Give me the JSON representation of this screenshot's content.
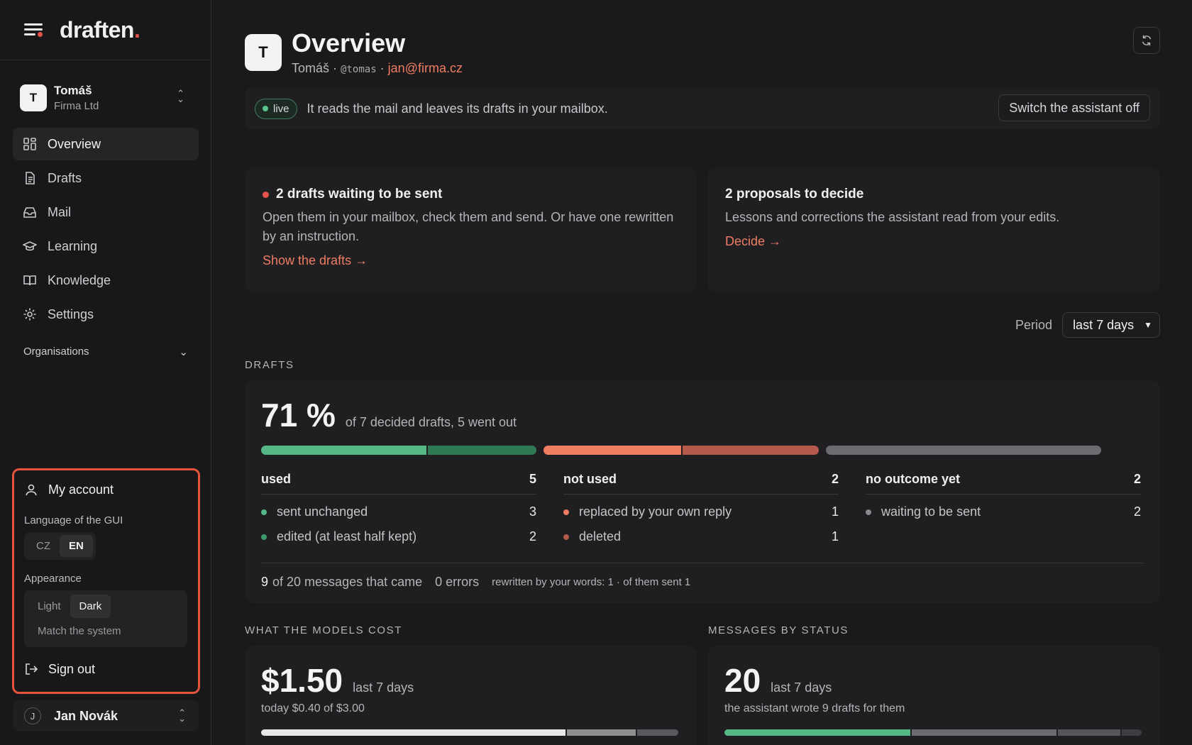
{
  "app": {
    "logo": "draften",
    "logo_dot": "."
  },
  "org": {
    "avatar": "T",
    "name": "Tomáš",
    "company": "Firma Ltd"
  },
  "nav": [
    {
      "label": "Overview",
      "icon": "grid-icon",
      "active": true
    },
    {
      "label": "Drafts",
      "icon": "document-icon"
    },
    {
      "label": "Mail",
      "icon": "inbox-icon"
    },
    {
      "label": "Learning",
      "icon": "graduation-cap-icon"
    },
    {
      "label": "Knowledge",
      "icon": "book-icon"
    },
    {
      "label": "Settings",
      "icon": "gear-icon"
    }
  ],
  "organisations_label": "Organisations",
  "account_menu": {
    "my_account": "My account",
    "language_label": "Language of the GUI",
    "languages": [
      "CZ",
      "EN"
    ],
    "language_selected": "EN",
    "appearance_label": "Appearance",
    "appearance_options": [
      "Light",
      "Dark"
    ],
    "appearance_selected": "Dark",
    "match_system": "Match the system",
    "sign_out": "Sign out"
  },
  "user": {
    "avatar": "J",
    "name": "Jan Novák"
  },
  "header": {
    "avatar": "T",
    "title": "Overview",
    "name": "Tomáš",
    "handle": "@tomas",
    "email": "jan@firma.cz",
    "separator": "·"
  },
  "status": {
    "badge": "live",
    "text": "It reads the mail and leaves its drafts in your mailbox.",
    "switch_off": "Switch the assistant off"
  },
  "cards": {
    "drafts_waiting": {
      "title": "2 drafts waiting to be sent",
      "text": "Open them in your mailbox, check them and send. Or have one rewritten by an instruction.",
      "link": "Show the drafts →"
    },
    "proposals": {
      "title": "2 proposals to decide",
      "text": "Lessons and corrections the assistant read from your edits.",
      "link": "Decide →"
    }
  },
  "period": {
    "label": "Period",
    "value": "last 7 days"
  },
  "drafts_section": {
    "label": "DRAFTS",
    "percent": "71 %",
    "summary": "of 7 decided drafts, 5 went out",
    "progress": [
      {
        "group": "used",
        "parts": [
          5,
          3,
          2
        ],
        "colors": [
          "#56b887",
          "#2f7a55"
        ]
      },
      {
        "group": "not used",
        "parts": [
          2,
          1,
          1
        ],
        "colors": [
          "#ef7d62",
          "#b55a4a"
        ]
      },
      {
        "group": "no outcome yet",
        "parts": [
          2,
          2
        ],
        "colors": [
          "#6b6b70"
        ]
      }
    ],
    "columns": [
      {
        "title": "used",
        "total": "5",
        "rows": [
          {
            "label": "sent unchanged",
            "value": "3",
            "color": "#56b887"
          },
          {
            "label": "edited (at least half kept)",
            "value": "2",
            "color": "#3e9a6c"
          }
        ]
      },
      {
        "title": "not used",
        "total": "2",
        "rows": [
          {
            "label": "replaced by your own reply",
            "value": "1",
            "color": "#ef7d62"
          },
          {
            "label": "deleted",
            "value": "1",
            "color": "#b55a4a"
          }
        ]
      },
      {
        "title": "no outcome yet",
        "total": "2",
        "rows": [
          {
            "label": "waiting to be sent",
            "value": "2",
            "color": "#8a8a8e"
          }
        ]
      }
    ],
    "footer": {
      "count": "9",
      "count_text": "of 20 messages that came",
      "errors": "0 errors",
      "rewritten": "rewritten by your words: 1 · of them sent 1"
    }
  },
  "cost_section": {
    "label": "WHAT THE MODELS COST",
    "amount": "$1.50",
    "period": "last 7 days",
    "today": "today $0.40 of $3.00"
  },
  "messages_section": {
    "label": "MESSAGES BY STATUS",
    "count": "20",
    "period": "last 7 days",
    "sub": "the assistant wrote 9 drafts for them"
  },
  "colors": {
    "accent": "#ef7d62",
    "green": "#56b887",
    "alert": "#e5534b"
  }
}
